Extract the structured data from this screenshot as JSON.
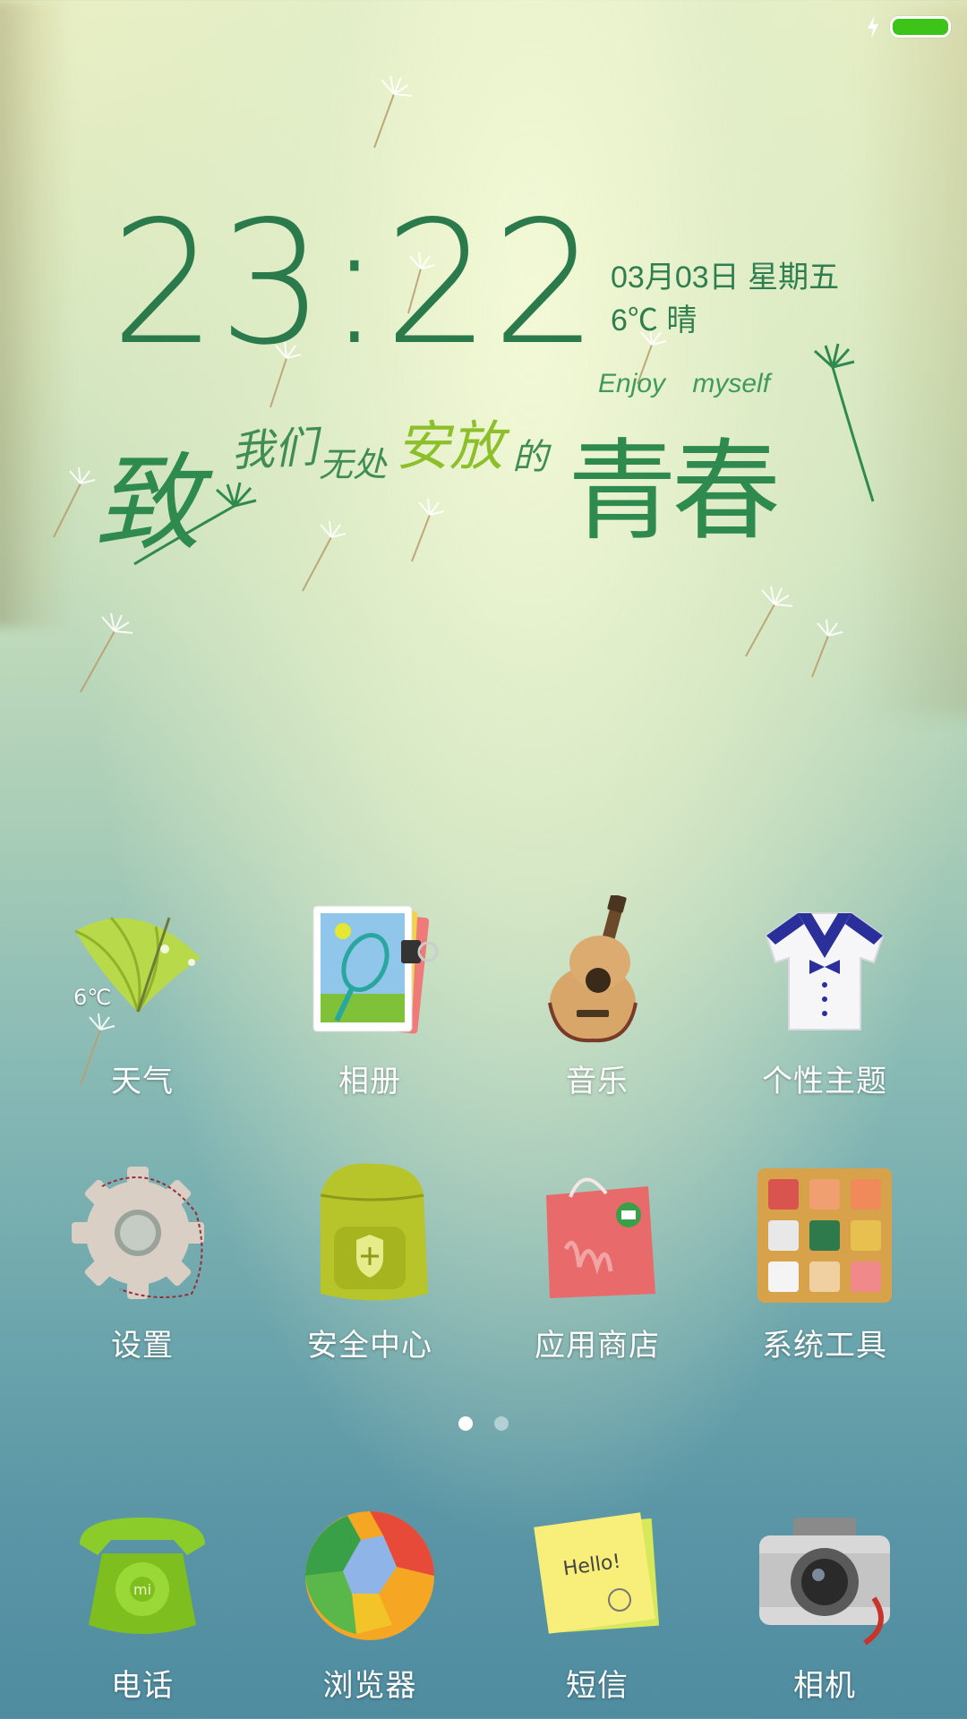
{
  "status_bar": {
    "charging_icon": "lightning-bolt-icon",
    "battery_icon": "battery-full-icon",
    "battery_color": "#3ec418"
  },
  "clock_widget": {
    "time": "23:22",
    "date": "03月03日  星期五",
    "weather": "6℃  晴"
  },
  "theme_art": {
    "line1_big": "致",
    "line1_a": "我们",
    "line1_b": "无处",
    "line1_c": "安放",
    "line1_d": "的",
    "line1_big2": "青春",
    "english": "Enjoy myself"
  },
  "apps": [
    {
      "label": "天气",
      "icon": "umbrella-weather-icon",
      "badge": "6℃"
    },
    {
      "label": "相册",
      "icon": "photo-album-icon"
    },
    {
      "label": "音乐",
      "icon": "guitar-music-icon"
    },
    {
      "label": "个性主题",
      "icon": "sailor-shirt-theme-icon"
    },
    {
      "label": "设置",
      "icon": "gear-settings-icon"
    },
    {
      "label": "安全中心",
      "icon": "backpack-security-icon"
    },
    {
      "label": "应用商店",
      "icon": "shopping-bag-store-icon"
    },
    {
      "label": "系统工具",
      "icon": "tools-board-icon"
    }
  ],
  "page_indicator": {
    "pages": 2,
    "current": 1
  },
  "dock": [
    {
      "label": "电话",
      "icon": "telephone-icon"
    },
    {
      "label": "浏览器",
      "icon": "ball-browser-icon"
    },
    {
      "label": "短信",
      "icon": "sticky-note-message-icon",
      "note_text": "Hello!"
    },
    {
      "label": "相机",
      "icon": "camera-icon"
    }
  ]
}
